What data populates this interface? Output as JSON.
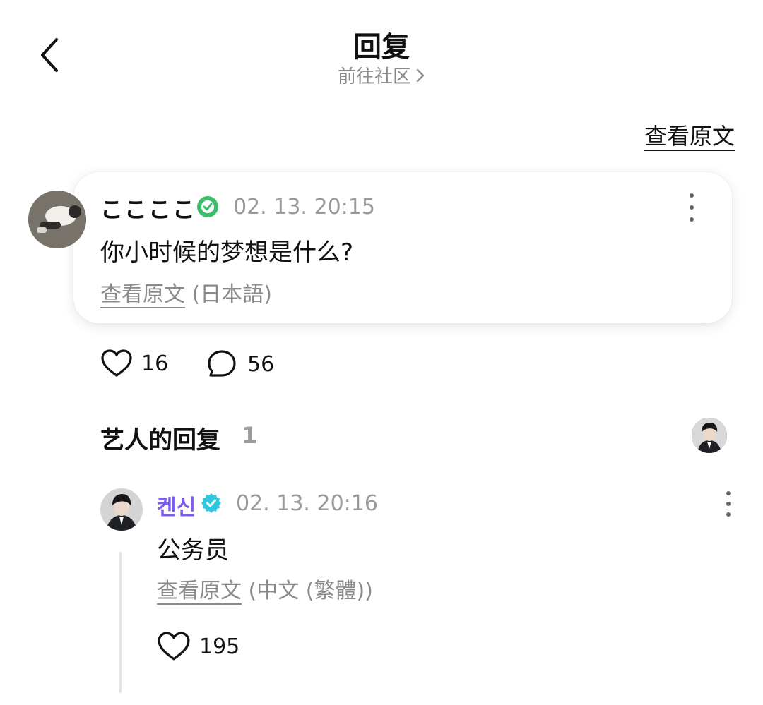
{
  "header": {
    "title": "回复",
    "subtitle": "前往社区",
    "view_original": "查看原文"
  },
  "post": {
    "author": "ここここ",
    "timestamp": "02. 13. 20:15",
    "text": "你小时候的梦想是什么?",
    "view_original": "查看原文",
    "original_language": "(日本語)",
    "likes": "16",
    "comments": "56",
    "badge_color": "#3dbd6c"
  },
  "artist_replies": {
    "title": "艺人的回复",
    "count": "1"
  },
  "reply": {
    "author": "켄신",
    "timestamp": "02. 13. 20:16",
    "text": "公务员",
    "view_original": "查看原文",
    "original_language": "(中文 (繁體))",
    "likes": "195",
    "name_color": "#7b5cf0",
    "badge_color": "#2fc7e0"
  }
}
